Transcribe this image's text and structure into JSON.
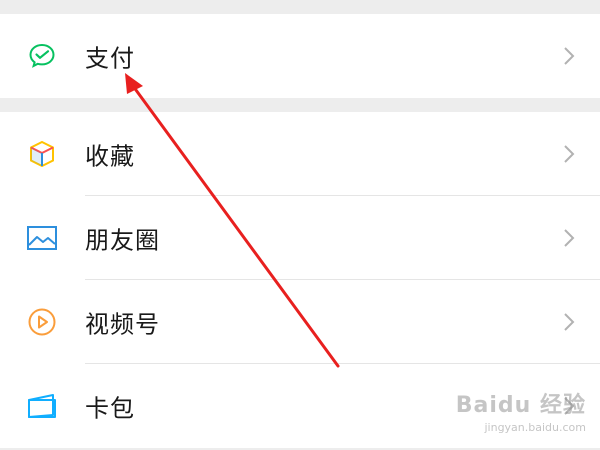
{
  "menu": {
    "group1": [
      {
        "label": "支付",
        "icon": "wechat-pay-icon",
        "color": "#07c160"
      }
    ],
    "group2": [
      {
        "label": "收藏",
        "icon": "favorites-cube-icon",
        "color": "#ffc300"
      },
      {
        "label": "朋友圈",
        "icon": "moments-picture-icon",
        "color": "#2d8fdd"
      },
      {
        "label": "视频号",
        "icon": "channels-play-icon",
        "color": "#fa9d3b"
      },
      {
        "label": "卡包",
        "icon": "card-wallet-icon",
        "color": "#10aeff"
      }
    ]
  },
  "annotation": {
    "arrow_color": "#e8201f"
  },
  "watermark": {
    "main": "Baidu 经验",
    "sub": "jingyan.baidu.com"
  }
}
